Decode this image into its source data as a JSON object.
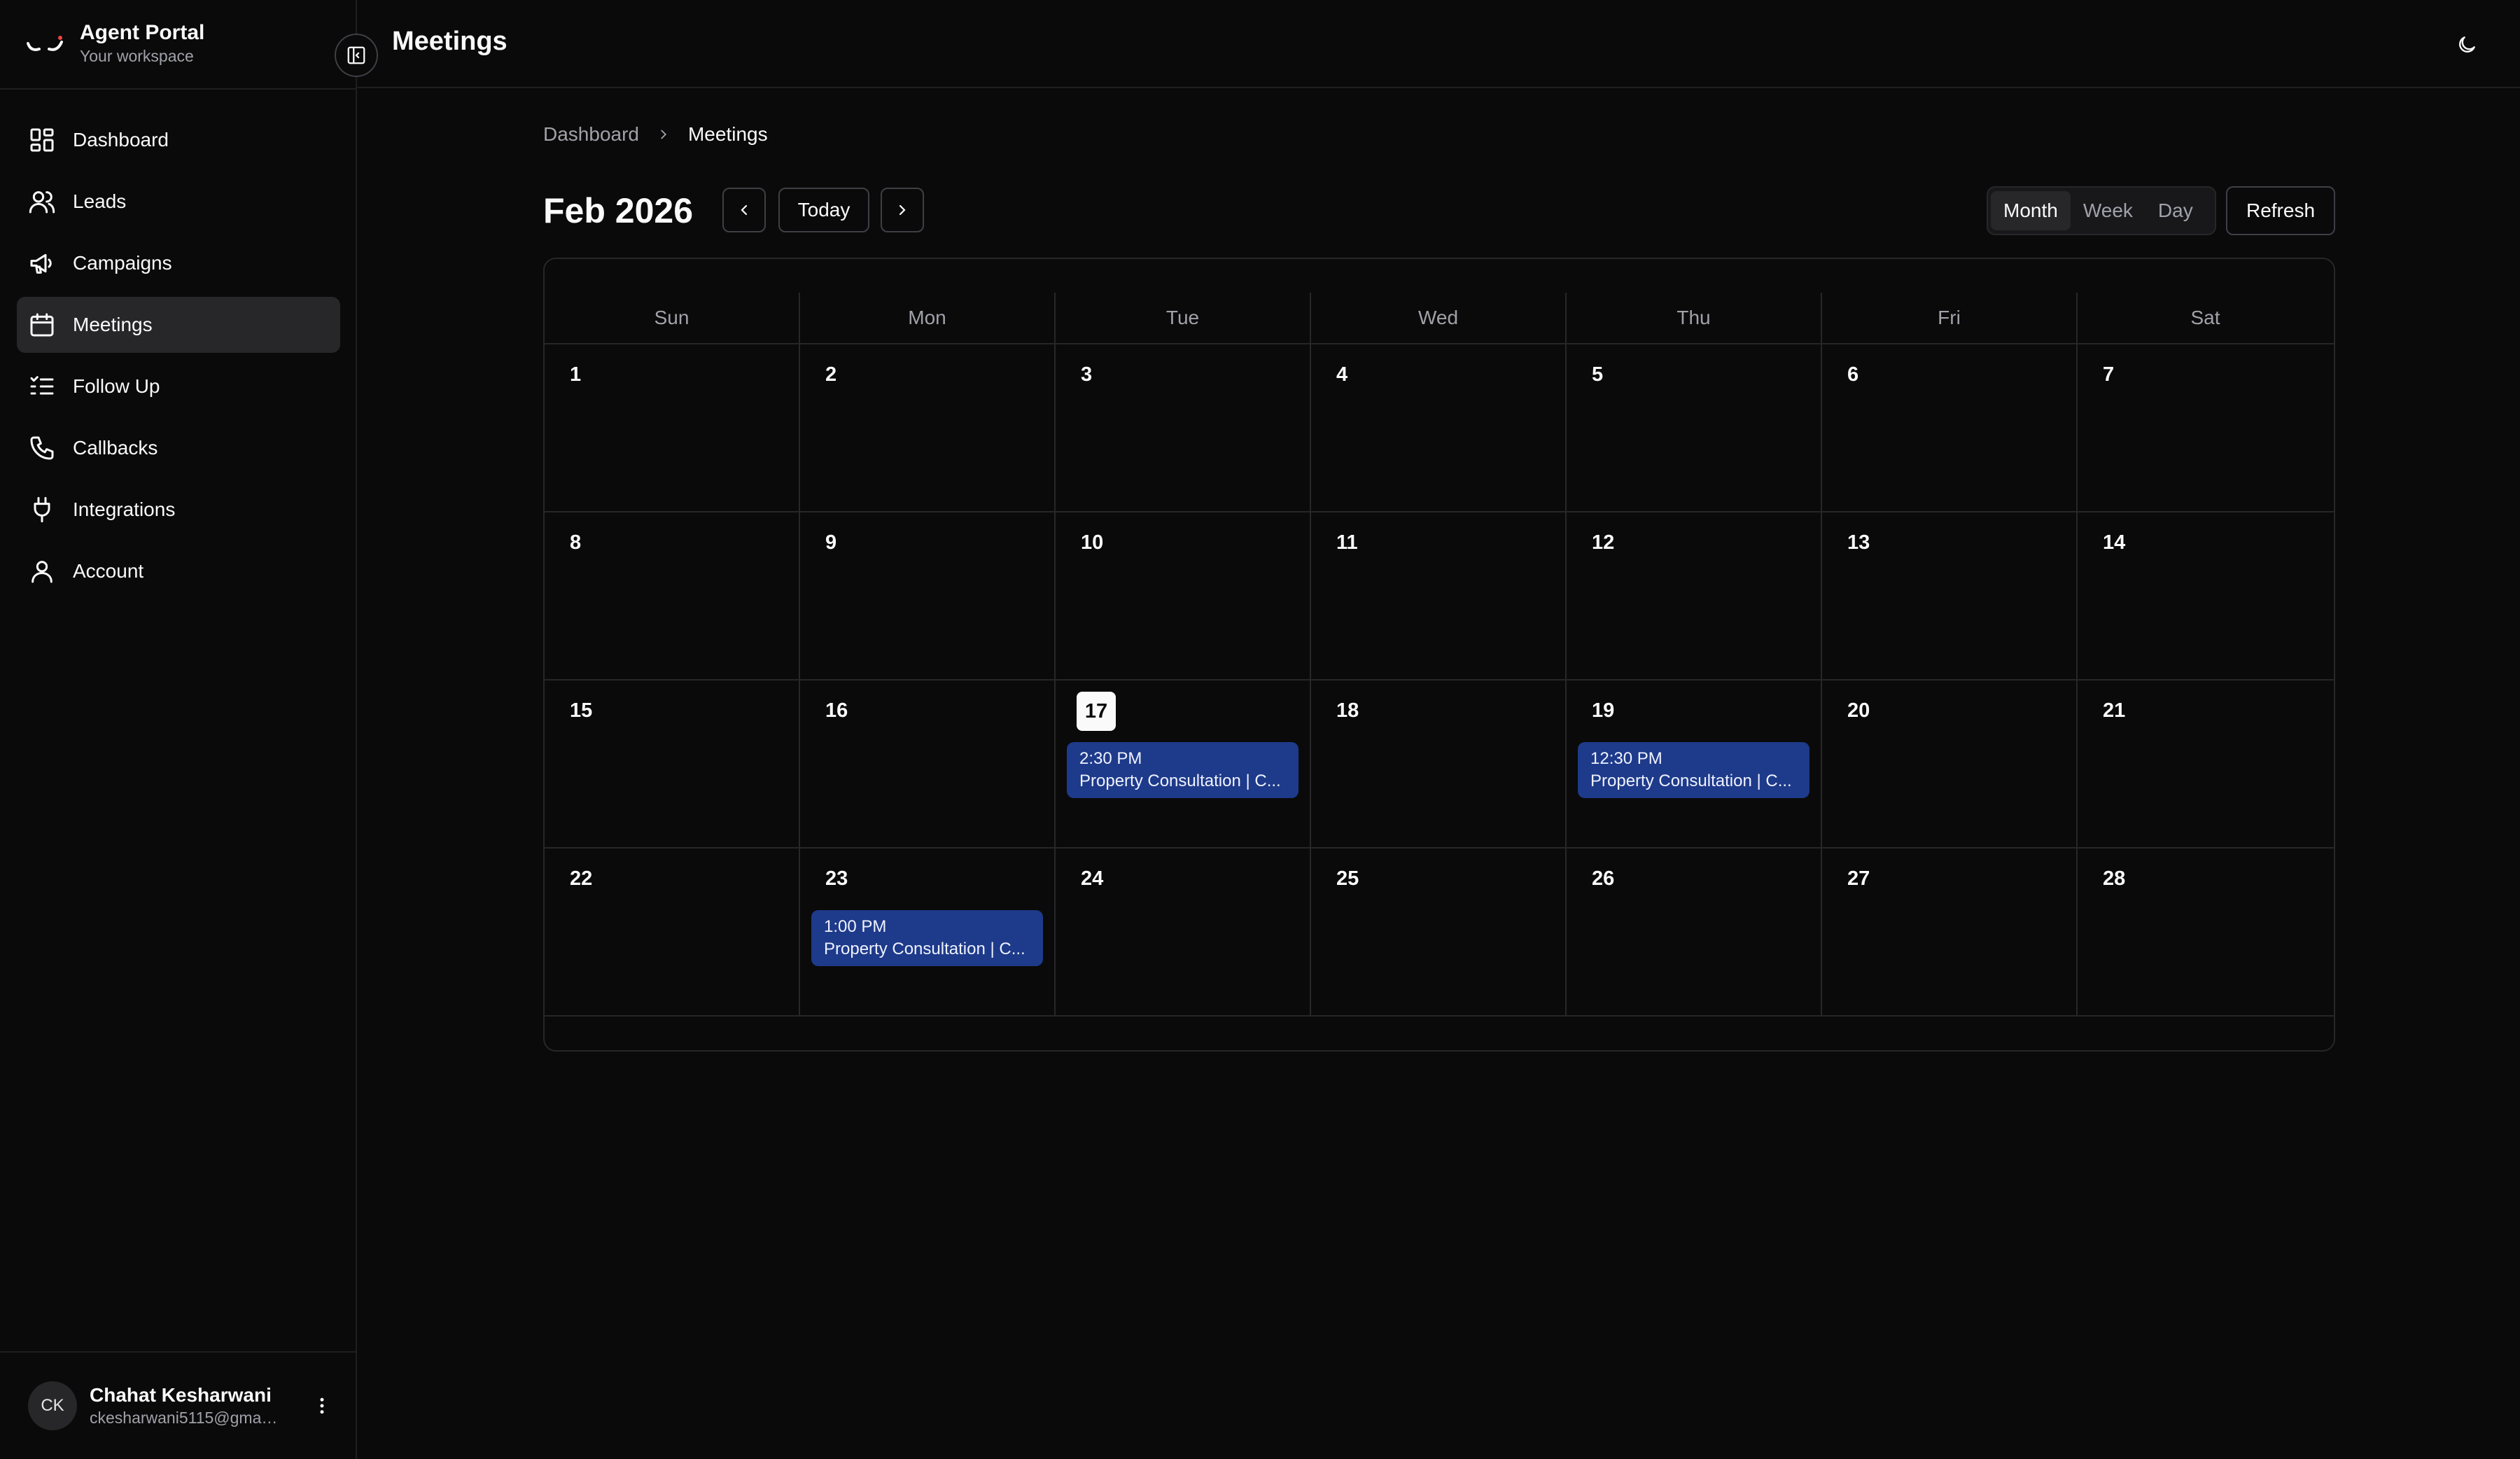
{
  "app": {
    "title": "Agent Portal",
    "subtitle": "Your workspace"
  },
  "sidebar": {
    "items": [
      {
        "label": "Dashboard",
        "icon": "dashboard-icon"
      },
      {
        "label": "Leads",
        "icon": "users-icon"
      },
      {
        "label": "Campaigns",
        "icon": "megaphone-icon"
      },
      {
        "label": "Meetings",
        "icon": "calendar-icon",
        "active": true
      },
      {
        "label": "Follow Up",
        "icon": "list-check-icon"
      },
      {
        "label": "Callbacks",
        "icon": "phone-icon"
      },
      {
        "label": "Integrations",
        "icon": "plug-icon"
      },
      {
        "label": "Account",
        "icon": "user-icon"
      }
    ]
  },
  "user": {
    "initials": "CK",
    "name": "Chahat Kesharwani",
    "email": "ckesharwani5115@gmail.com"
  },
  "header": {
    "title": "Meetings"
  },
  "breadcrumb": {
    "parent": "Dashboard",
    "current": "Meetings"
  },
  "toolbar": {
    "month_label": "Feb 2026",
    "today_label": "Today",
    "views": [
      "Month",
      "Week",
      "Day"
    ],
    "active_view": "Month",
    "refresh_label": "Refresh"
  },
  "calendar": {
    "weekdays": [
      "Sun",
      "Mon",
      "Tue",
      "Wed",
      "Thu",
      "Fri",
      "Sat"
    ],
    "today": 17,
    "weeks": [
      [
        1,
        2,
        3,
        4,
        5,
        6,
        7
      ],
      [
        8,
        9,
        10,
        11,
        12,
        13,
        14
      ],
      [
        15,
        16,
        17,
        18,
        19,
        20,
        21
      ],
      [
        22,
        23,
        24,
        25,
        26,
        27,
        28
      ]
    ],
    "events": [
      {
        "day": 17,
        "time": "2:30 PM",
        "title": "Property Consultation | C..."
      },
      {
        "day": 19,
        "time": "12:30 PM",
        "title": "Property Consultation | C..."
      },
      {
        "day": 23,
        "time": "1:00 PM",
        "title": "Property Consultation | C..."
      }
    ],
    "event_color": "#1e3a8a"
  }
}
